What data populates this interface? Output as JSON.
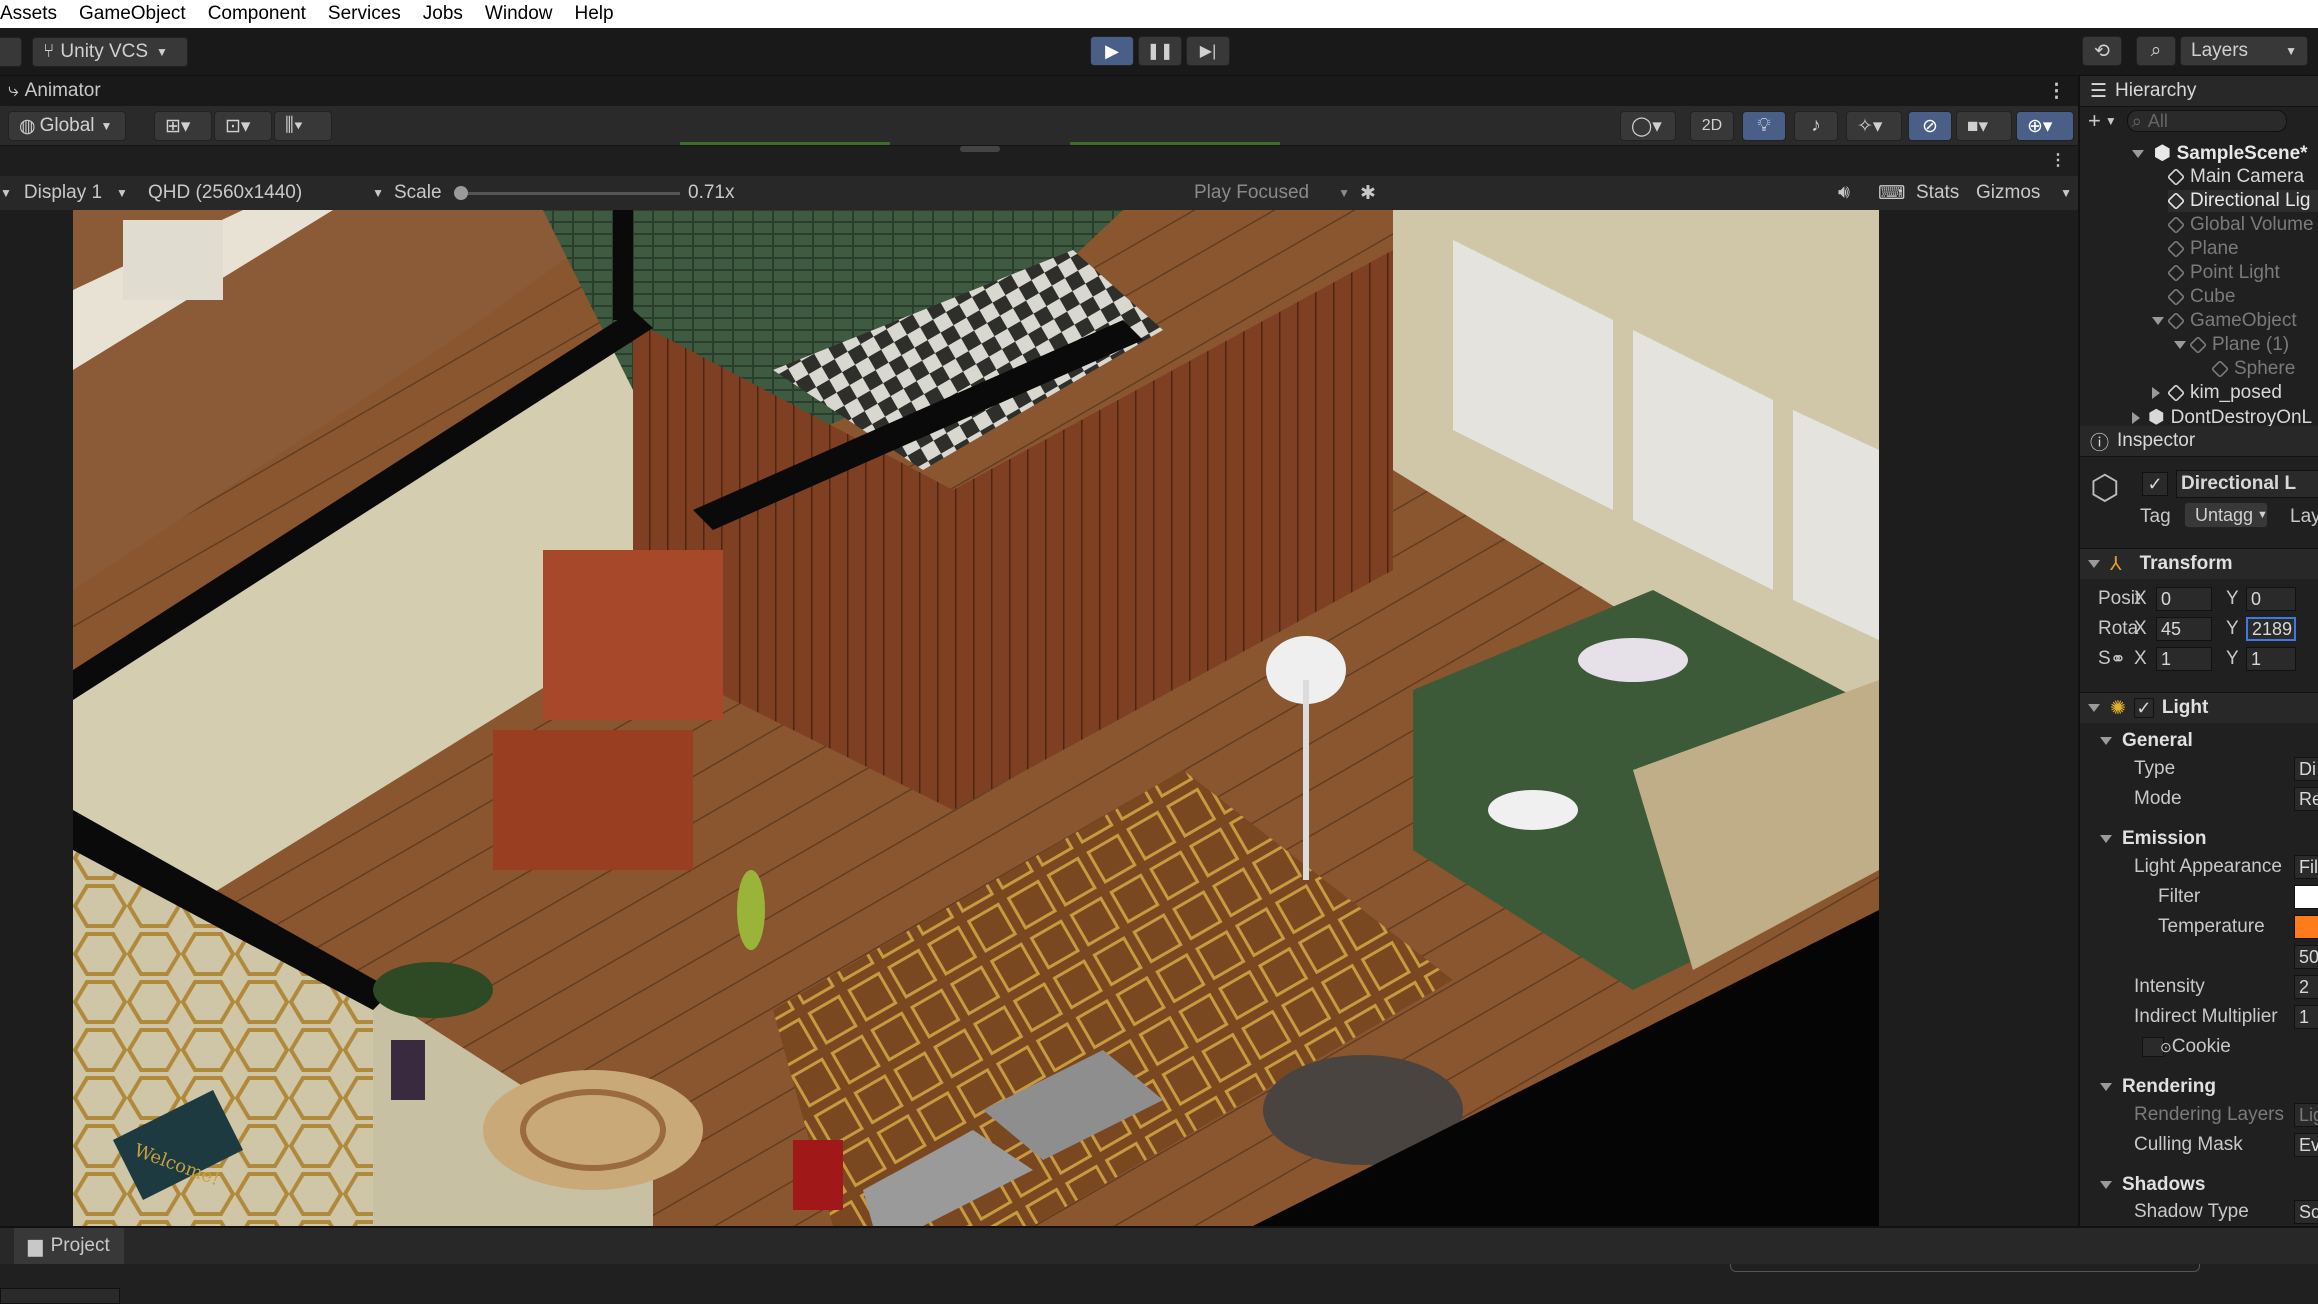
{
  "menu": [
    "Assets",
    "GameObject",
    "Component",
    "Services",
    "Jobs",
    "Window",
    "Help"
  ],
  "toolbar": {
    "vcs_label": "Unity VCS",
    "layers_label": "Layers"
  },
  "animator": {
    "tab_label": "Animator"
  },
  "scene_toolbar": {
    "global_label": "Global",
    "mode_2d": "2D"
  },
  "game_toolbar": {
    "display": "Display 1",
    "resolution": "QHD (2560x1440)",
    "scale_label": "Scale",
    "scale_value": "0.71x",
    "play_mode": "Play Focused",
    "stats_label": "Stats",
    "gizmos_label": "Gizmos"
  },
  "hierarchy": {
    "title": "Hierarchy",
    "search_placeholder": "All",
    "scene": "SampleScene*",
    "items": [
      {
        "label": "Main Camera"
      },
      {
        "label": "Directional Lig"
      },
      {
        "label": "Global Volume"
      },
      {
        "label": "Plane"
      },
      {
        "label": "Point Light"
      },
      {
        "label": "Cube"
      },
      {
        "label": "GameObject"
      },
      {
        "label": "Plane (1)"
      },
      {
        "label": "Sphere"
      },
      {
        "label": "kim_posed"
      }
    ],
    "dont_destroy": "DontDestroyOnL"
  },
  "inspector": {
    "title": "Inspector",
    "object_name": "Directional L",
    "tag_label": "Tag",
    "tag_value": "Untagg",
    "layer_label": "Lay",
    "transform": {
      "title": "Transform",
      "position_label": "Posit",
      "rotation_label": "Rota",
      "scale_label": "S",
      "x_label": "X",
      "y_label": "Y",
      "pos_x": "0",
      "pos_y": "0",
      "rot_x": "45",
      "rot_y": "2189",
      "scale_x": "1",
      "scale_y": "1"
    },
    "light": {
      "title": "Light",
      "general": "General",
      "type_label": "Type",
      "type_value": "Di",
      "mode_label": "Mode",
      "mode_value": "Re",
      "emission": "Emission",
      "appearance_label": "Light Appearance",
      "appearance_value": "Fil",
      "filter_label": "Filter",
      "temperature_label": "Temperature",
      "temperature_value": "50",
      "intensity_label": "Intensity",
      "intensity_value": "2",
      "indirect_label": "Indirect Multiplier",
      "indirect_value": "1",
      "cookie_label": "Cookie",
      "rendering": "Rendering",
      "rendering_layers_label": "Rendering Layers",
      "rendering_layers_value": "Lig",
      "culling_label": "Culling Mask",
      "culling_value": "Ev",
      "shadows": "Shadows",
      "shadow_type_label": "Shadow Type",
      "shadow_type_value": "Sc"
    }
  },
  "project": {
    "tab_label": "Project"
  },
  "game_scene": {
    "doormat_text": "Welcome!"
  },
  "colors": {
    "accent": "#4a5f87",
    "selected_row": "#2c2c2c",
    "temperature_swatch": "#ff7a1a",
    "filter_swatch": "#ffffff"
  }
}
